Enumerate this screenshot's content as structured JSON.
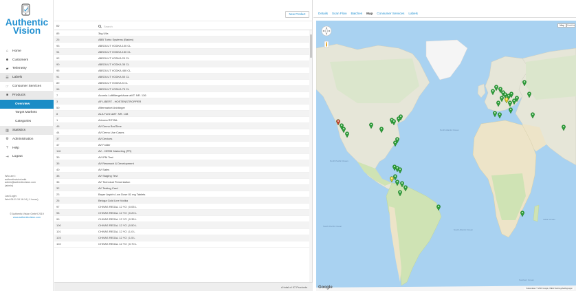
{
  "brand": {
    "line1": "Authentic",
    "line2": "Vision",
    "color": "#1f8fd0"
  },
  "nav": [
    {
      "name": "nav-home",
      "icon": "home-icon",
      "glyph": "⌂",
      "label": "Home",
      "cls": ""
    },
    {
      "name": "nav-customers",
      "icon": "users-icon",
      "glyph": "☻",
      "label": "Customers",
      "cls": ""
    },
    {
      "name": "nav-telemetry",
      "icon": "car-icon",
      "glyph": "▰",
      "label": "Telemetry",
      "cls": ""
    },
    {
      "name": "nav-labels",
      "icon": "list-icon",
      "glyph": "☰",
      "label": "Labels",
      "cls": "grey"
    },
    {
      "name": "nav-consumer-services",
      "icon": "hand-icon",
      "glyph": "☞",
      "label": "Consumer Services",
      "cls": ""
    },
    {
      "name": "nav-products",
      "icon": "product-icon",
      "glyph": "■",
      "label": "Products",
      "cls": "grey"
    },
    {
      "name": "nav-overview",
      "icon": "",
      "glyph": "",
      "label": "Overview",
      "cls": "active"
    },
    {
      "name": "nav-target-markets",
      "icon": "",
      "glyph": "",
      "label": "Target Markets",
      "cls": "sub"
    },
    {
      "name": "nav-categories",
      "icon": "",
      "glyph": "",
      "label": "Categories",
      "cls": "sub"
    },
    {
      "name": "nav-statistics",
      "icon": "chart-icon",
      "glyph": "▥",
      "label": "Statistics",
      "cls": "grey"
    },
    {
      "name": "nav-administration",
      "icon": "gears-icon",
      "glyph": "⚙",
      "label": "Administration",
      "cls": ""
    },
    {
      "name": "nav-help",
      "icon": "question-icon",
      "glyph": "?",
      "label": "Help",
      "cls": ""
    },
    {
      "name": "nav-logout",
      "icon": "logout-icon",
      "glyph": "⇥",
      "label": "Logout",
      "cls": ""
    }
  ],
  "user": {
    "who_label": "Who am I:",
    "who_lines": [
      "authenticvision\\mkk",
      "admin@authenticvision.com",
      "(admin)"
    ],
    "login_label": "Last Login:",
    "login_value": "Wed 06.11.19 16:14 (-1 hours)",
    "copyright": "© Authentic Vision GmbH 2019",
    "url": "www.authenticvision.com"
  },
  "toolbar": {
    "new_product_label": "New Product"
  },
  "table": {
    "id_header": "ID",
    "search_placeholder": "Search",
    "footer": "A total of 97 Products",
    "rows": [
      [
        "85",
        "3kg Ulla"
      ],
      [
        "25",
        "ABB Turbo Systems (Baden)"
      ],
      [
        "93",
        "ABSOLUT VODKA 100 CL"
      ],
      [
        "94",
        "ABSOLUT VODKA 150 CL"
      ],
      [
        "92",
        "ABSOLUT VODKA 20 CL"
      ],
      [
        "90",
        "ABSOLUT VODKA 35 CL"
      ],
      [
        "95",
        "ABSOLUT VODKA 450 CL"
      ],
      [
        "91",
        "ABSOLUT VODKA 50 CL"
      ],
      [
        "89",
        "ABSOLUT VODKA 5 CL"
      ],
      [
        "96",
        "ABSOLUT VODKA 75 CL"
      ],
      [
        "7",
        "Acomia Luftfiltergehäuse aMT. NR. 136"
      ],
      [
        "3",
        "AF LIBERT - HOSTENSTROPPER"
      ],
      [
        "50",
        "Aftermarket Anhänger"
      ],
      [
        "8",
        "ALA Forte aMT. NR. 138"
      ],
      [
        "1",
        "Arizona RETAIL"
      ],
      [
        "46",
        "AV Demo BedTime"
      ],
      [
        "44",
        "AV Demo Use Cases"
      ],
      [
        "37",
        "AV Devices"
      ],
      [
        "47",
        "AV Folder"
      ],
      [
        "116",
        "AV - HERM Marketing (PR)"
      ],
      [
        "39",
        "AV IPM Test"
      ],
      [
        "35",
        "AV Research & Development"
      ],
      [
        "40",
        "AV Sales"
      ],
      [
        "38",
        "AV Staging Test"
      ],
      [
        "36",
        "AV Technical Presentation"
      ],
      [
        "32",
        "AV Testing Card"
      ],
      [
        "23",
        "Bayer Aspirin Low Dose 81 mg Tablets"
      ],
      [
        "26",
        "Beluga Gold Line Vodka"
      ],
      [
        "97",
        "CHIVAS REGAL 12 YO | 0.05 L"
      ],
      [
        "98",
        "CHIVAS REGAL 12 YO | 0.20 L"
      ],
      [
        "99",
        "CHIVAS REGAL 12 YO | 0.35 L"
      ],
      [
        "100",
        "CHIVAS REGAL 12 YO | 0.50 L"
      ],
      [
        "101",
        "CHIVAS REGAL 12 YO | 1.0 L"
      ],
      [
        "103",
        "CHIVAS REGAL 12 YO | 1.5 L"
      ],
      [
        "102",
        "CHIVAS REGAL 12 YO | 0.70 L"
      ]
    ]
  },
  "tabs": [
    {
      "name": "tab-details",
      "label": "Details",
      "active": false
    },
    {
      "name": "tab-scan-flow",
      "label": "Scan Flow",
      "active": false
    },
    {
      "name": "tab-batches",
      "label": "Batches",
      "active": false
    },
    {
      "name": "tab-map",
      "label": "Map",
      "active": true
    },
    {
      "name": "tab-consumer-services",
      "label": "Consumer Services",
      "active": false
    },
    {
      "name": "tab-labels",
      "label": "Labels",
      "active": false
    }
  ],
  "map": {
    "type_buttons": [
      "Map",
      "Satellite"
    ],
    "google": "Google",
    "footer": "Kartendaten © 2019 Google, INEGI   Nutzungsbedingungen",
    "ocean_labels": [
      "North Atlantic Ocean",
      "South Atlantic Ocean",
      "North Pacific Ocean",
      "South Pacific Ocean",
      "Indian Ocean",
      "Southern Ocean"
    ],
    "colors": {
      "water": "#a9d2f1",
      "land": "#e6e6d8",
      "green": "#cfe3b4",
      "desert": "#ede4c8",
      "ice": "#f5f5f5",
      "marker": "#2e9e3a",
      "marker_dark": "#1d6f25",
      "marker_red": "#c9402f",
      "marker_yellow": "#e3c52a"
    }
  }
}
